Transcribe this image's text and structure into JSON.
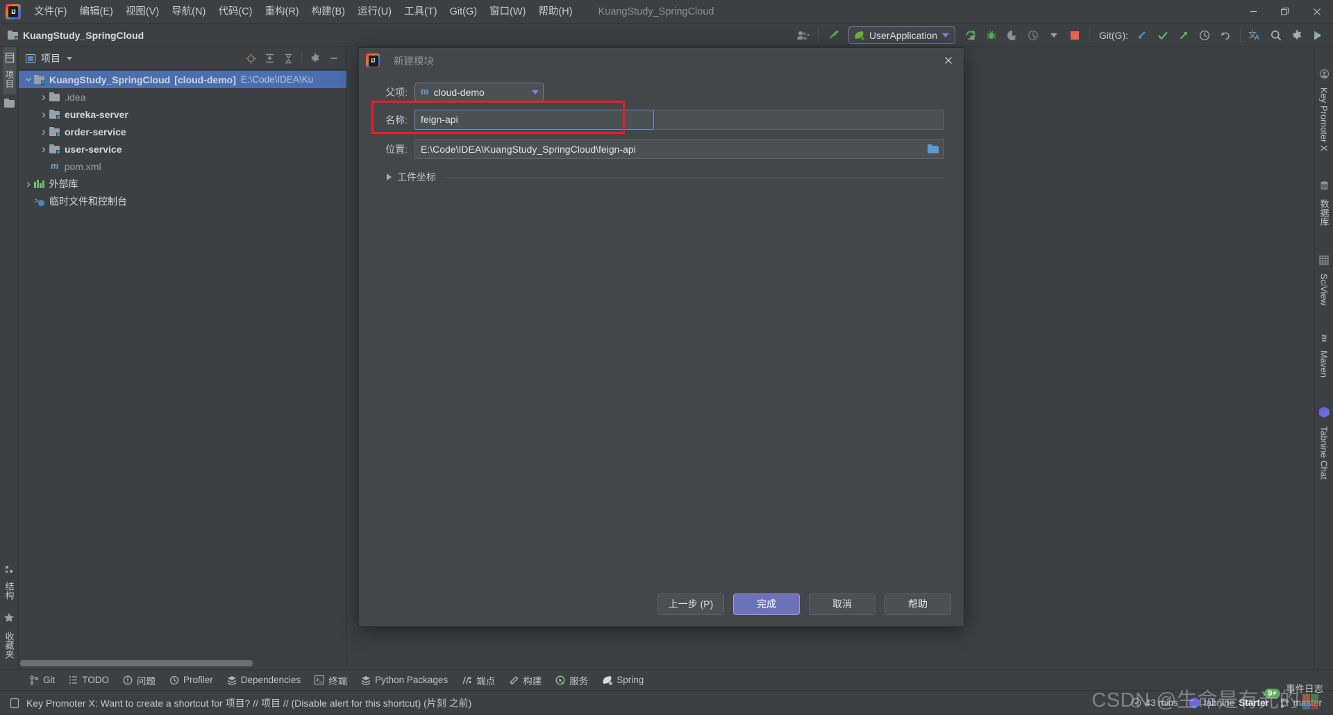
{
  "window": {
    "title": "KuangStudy_SpringCloud",
    "minimize": "–",
    "maximize": "❐",
    "close": "✕"
  },
  "menubar": {
    "items": [
      {
        "label": "文件(F)",
        "key": "F"
      },
      {
        "label": "编辑(E)",
        "key": "E"
      },
      {
        "label": "视图(V)",
        "key": "V"
      },
      {
        "label": "导航(N)",
        "key": "N"
      },
      {
        "label": "代码(C)",
        "key": "C"
      },
      {
        "label": "重构(R)",
        "key": "R"
      },
      {
        "label": "构建(B)",
        "key": "B"
      },
      {
        "label": "运行(U)",
        "key": "U"
      },
      {
        "label": "工具(T)",
        "key": "T"
      },
      {
        "label": "Git(G)",
        "key": "G"
      },
      {
        "label": "窗口(W)",
        "key": "W"
      },
      {
        "label": "帮助(H)",
        "key": "H"
      }
    ]
  },
  "toolbar": {
    "project_name": "KuangStudy_SpringCloud",
    "run_config": "UserApplication",
    "git_label": "Git(G):",
    "icons": [
      "account-icon",
      "build-hammer-icon",
      "run-icon",
      "debug-icon",
      "run-with-coverage-icon",
      "profiler-icon",
      "stop-icon",
      "git-update-icon",
      "git-commit-icon",
      "git-push-icon",
      "git-history-icon",
      "git-rollback-icon",
      "translate-icon",
      "search-everywhere-icon",
      "settings-gear-icon",
      "plugin-icon"
    ]
  },
  "left_strip": {
    "top": [
      {
        "label": "项目",
        "name": "project"
      }
    ],
    "bottom": [
      {
        "label": "结构",
        "name": "structure"
      },
      {
        "label": "收藏夹",
        "name": "favorites"
      }
    ]
  },
  "right_strip": {
    "items": [
      {
        "label": "Key Promoter X"
      },
      {
        "label": "数据库"
      },
      {
        "label": "SciView"
      },
      {
        "label": "Maven"
      },
      {
        "label": "Tabnine Chat"
      }
    ]
  },
  "project_panel": {
    "title": "项目",
    "tool_icons": [
      "locate-target-icon",
      "expand-all-icon",
      "collapse-all-icon",
      "settings-gear-icon",
      "hide-minus-icon"
    ],
    "tree": [
      {
        "label": "KuangStudy_SpringCloud",
        "suffix": "[cloud-demo]",
        "path": "E:\\Code\\IDEA\\Ku",
        "indent": 0,
        "arrow": "down",
        "icon": "module-folder-icon",
        "selected": true,
        "bold": true
      },
      {
        "label": ".idea",
        "indent": 1,
        "arrow": "right",
        "icon": "folder-icon",
        "dim": true
      },
      {
        "label": "eureka-server",
        "indent": 1,
        "arrow": "right",
        "icon": "module-folder-icon",
        "bold": true
      },
      {
        "label": "order-service",
        "indent": 1,
        "arrow": "right",
        "icon": "module-folder-icon",
        "bold": true
      },
      {
        "label": "user-service",
        "indent": 1,
        "arrow": "right",
        "icon": "module-folder-icon",
        "bold": true
      },
      {
        "label": "pom.xml",
        "indent": 1,
        "arrow": "none",
        "icon": "maven-pom-icon"
      },
      {
        "label": "外部库",
        "indent": 0,
        "arrow": "right",
        "icon": "library-icon"
      },
      {
        "label": "临时文件和控制台",
        "indent": 0,
        "arrow": "none",
        "icon": "scratches-icon"
      }
    ]
  },
  "dialog": {
    "title": "新建模块",
    "close_icon": "close-icon",
    "fields": {
      "parent_label": "父项:",
      "parent_value": "cloud-demo",
      "parent_icon": "maven-m-icon",
      "name_label": "名称:",
      "name_value": "feign-api",
      "location_label": "位置:",
      "location_value": "E:\\Code\\IDEA\\KuangStudy_SpringCloud\\feign-api",
      "browse_icon": "folder-browse-icon",
      "coordinates_label": "工件坐标"
    },
    "buttons": [
      {
        "label": "上一步 (P)",
        "name": "previous-button",
        "primary": false
      },
      {
        "label": "完成",
        "name": "finish-button",
        "primary": true
      },
      {
        "label": "取消",
        "name": "cancel-button",
        "primary": false
      },
      {
        "label": "帮助",
        "name": "help-button",
        "primary": false
      }
    ]
  },
  "tool_windows": [
    {
      "label": "Git",
      "icon": "git-branch-icon"
    },
    {
      "label": "TODO",
      "icon": "todo-list-icon"
    },
    {
      "label": "问题",
      "icon": "problems-icon"
    },
    {
      "label": "Profiler",
      "icon": "profiler-icon"
    },
    {
      "label": "Dependencies",
      "icon": "dependencies-icon"
    },
    {
      "label": "终端",
      "icon": "terminal-icon"
    },
    {
      "label": "Python Packages",
      "icon": "python-packages-icon"
    },
    {
      "label": "端点",
      "icon": "endpoints-icon"
    },
    {
      "label": "构建",
      "icon": "build-hammer-icon"
    },
    {
      "label": "服务",
      "icon": "services-icon"
    },
    {
      "label": "Spring",
      "icon": "spring-leaf-icon"
    }
  ],
  "status_bar": {
    "message": "Key Promoter X: Want to create a shortcut for 项目? // 项目 // (Disable alert for this shortcut) (片刻 之前)",
    "message_icon": "notification-icon",
    "event_log": "事件日志",
    "event_badge": "9+",
    "time": "43 mins",
    "time_icon": "clock-icon",
    "tabnine": "tabnine",
    "tabnine_plan": "Starter",
    "branch": "master",
    "branch_icon": "git-branch-icon"
  },
  "watermark": "CSDN @生命是有光的",
  "colors": {
    "bg": "#3c4043",
    "panel": "#43474a",
    "selection": "#4b6eaf",
    "accent_purple": "#b392e0",
    "primary_button": "#6a73b8",
    "red_highlight": "#ee1c25",
    "green": "#6db33f",
    "blue": "#4a88c7"
  }
}
